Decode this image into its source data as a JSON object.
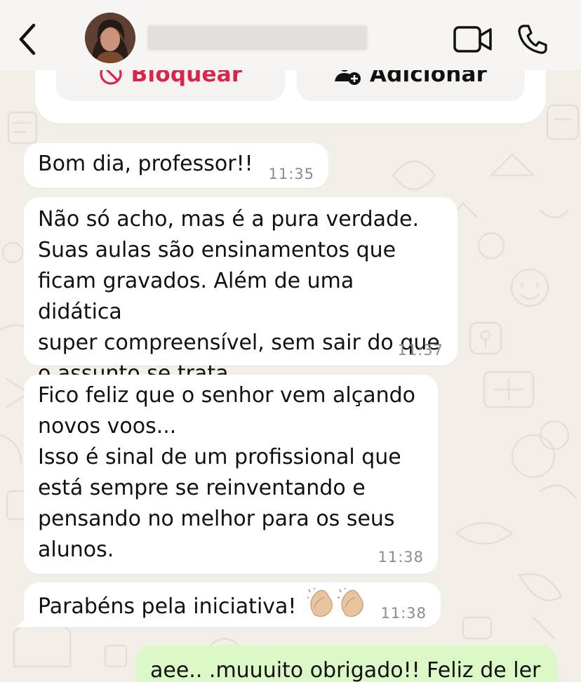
{
  "header": {
    "contact_name": "",
    "back_icon": "chevron-left-icon",
    "video_icon": "video-camera-icon",
    "call_icon": "phone-icon"
  },
  "contact_card": {
    "block_label": "Bloquear",
    "add_label": "Adicionar",
    "block_color": "#d8254a"
  },
  "messages": [
    {
      "text": "Bom dia, professor!!",
      "time": "11:35",
      "direction": "incoming"
    },
    {
      "text": "Não só acho, mas é a pura verdade.\nSuas aulas são ensinamentos que\nficam gravados. Além de uma didática\nsuper compreensível, sem sair do que\no assunto se trata.",
      "time": "11:37",
      "direction": "incoming"
    },
    {
      "text": "Fico feliz que o senhor vem alçando\nnovos voos...\nIsso é sinal de um profissional que\nestá sempre se reinventando e\npensando no melhor para os seus\nalunos.",
      "time": "11:38",
      "direction": "incoming"
    },
    {
      "text": "Parabéns pela iniciativa!",
      "emoji": "clapping-hands-icon",
      "time": "11:38",
      "direction": "incoming"
    },
    {
      "text": "aee.. .muuuito obrigado!! Feliz de ler",
      "direction": "outgoing"
    }
  ],
  "colors": {
    "outgoing_bubble": "#dcf8c6",
    "incoming_bubble": "#ffffff",
    "wallpaper": "#f2efe9"
  }
}
